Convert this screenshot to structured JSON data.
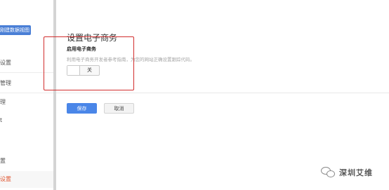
{
  "sidebar": {
    "create_view_button": "刚建数据视图",
    "items": [
      {
        "label": "设置"
      },
      {
        "label": "管理"
      },
      {
        "label": "理"
      },
      {
        "label": "t"
      },
      {
        "label": "置"
      },
      {
        "label": "设置",
        "active": true
      }
    ]
  },
  "ecommerce": {
    "title": "设置电子商务",
    "field_label": "启用电子商务",
    "field_description": "利用电子商务开发者参考指南，为您的网站正确设置跟踪代码。",
    "toggle_state": "关"
  },
  "actions": {
    "save_label": "保存",
    "cancel_label": "取消"
  },
  "watermark": {
    "text": "深圳艾维"
  },
  "colors": {
    "primary_button": "#4a86e8",
    "annotation": "#d22d2d",
    "active_nav": "#e05a35"
  },
  "icons": {
    "watermark_icon": "wechat-icon"
  }
}
